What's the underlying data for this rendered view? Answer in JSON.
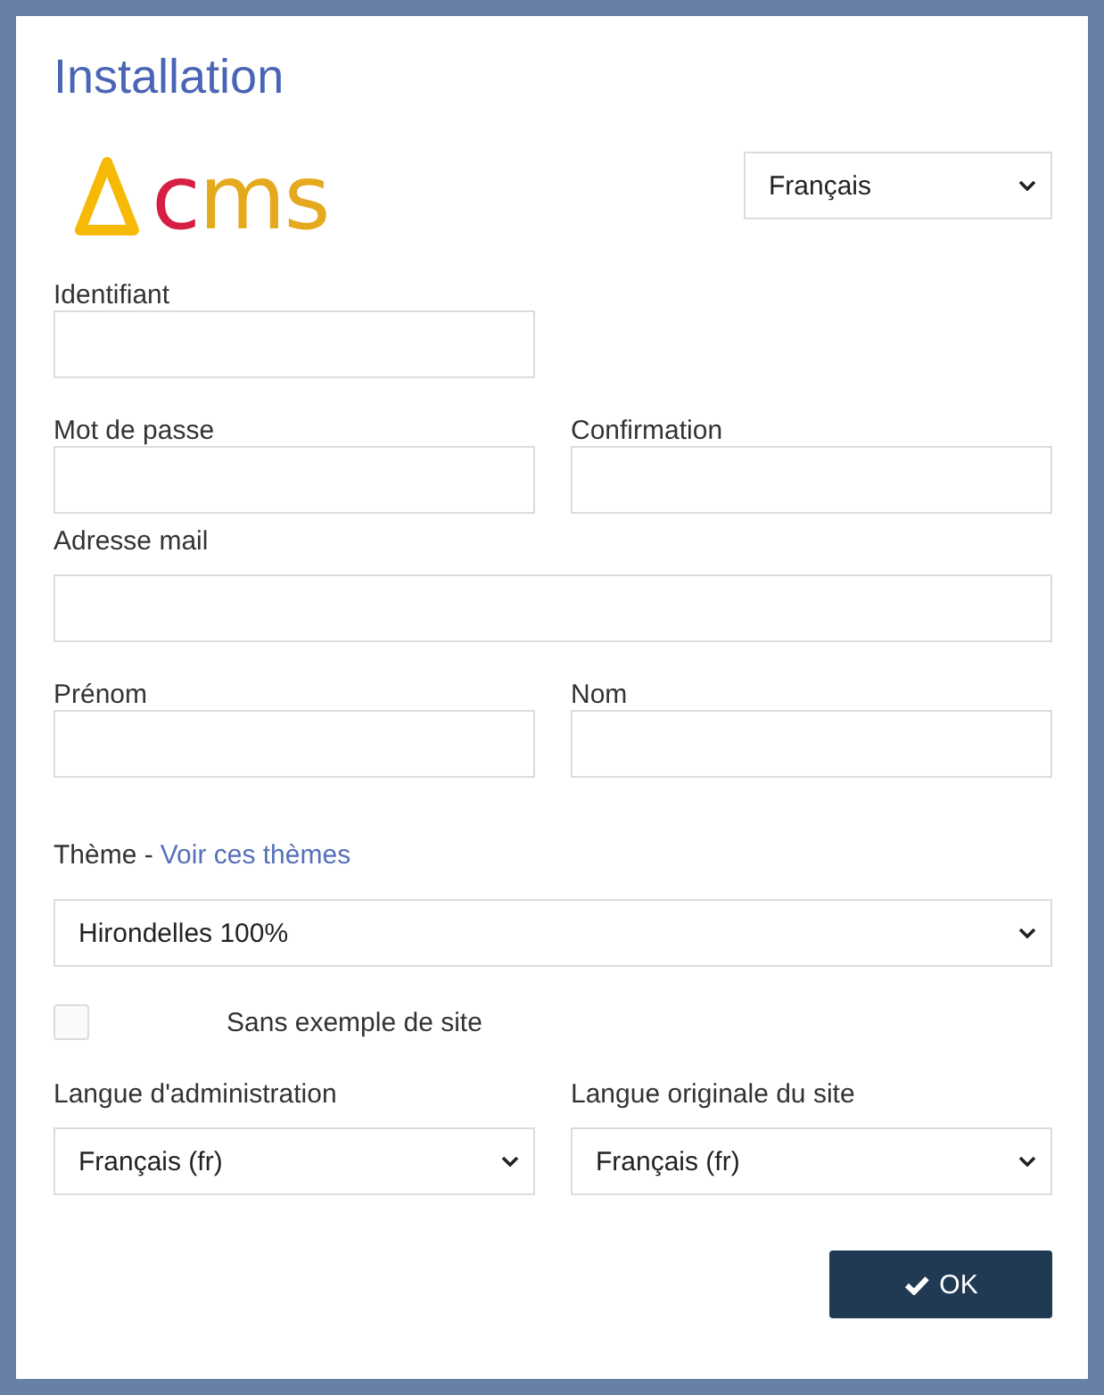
{
  "title": "Installation",
  "logo": {
    "text": "cms"
  },
  "site_language": {
    "value": "Français"
  },
  "account_rows": [
    [
      {
        "label": "Identifiant"
      }
    ],
    [
      {
        "label": "Mot de passe"
      },
      {
        "label": "Confirmation"
      }
    ],
    [
      {
        "label": "Adresse mail",
        "full_width": true
      }
    ],
    [
      {
        "label": "Prénom"
      },
      {
        "label": "Nom"
      }
    ]
  ],
  "theme": {
    "label": "Thème -",
    "link": "Voir ces thèmes",
    "value": "Hirondelles 100%"
  },
  "sample_site": {
    "label": "Sans exemple de site",
    "checked": false
  },
  "languages": [
    {
      "label": "Langue d'administration",
      "value": "Français (fr)"
    },
    {
      "label": "Langue originale du site",
      "value": "Français (fr)"
    }
  ],
  "submit": {
    "label": "OK"
  }
}
